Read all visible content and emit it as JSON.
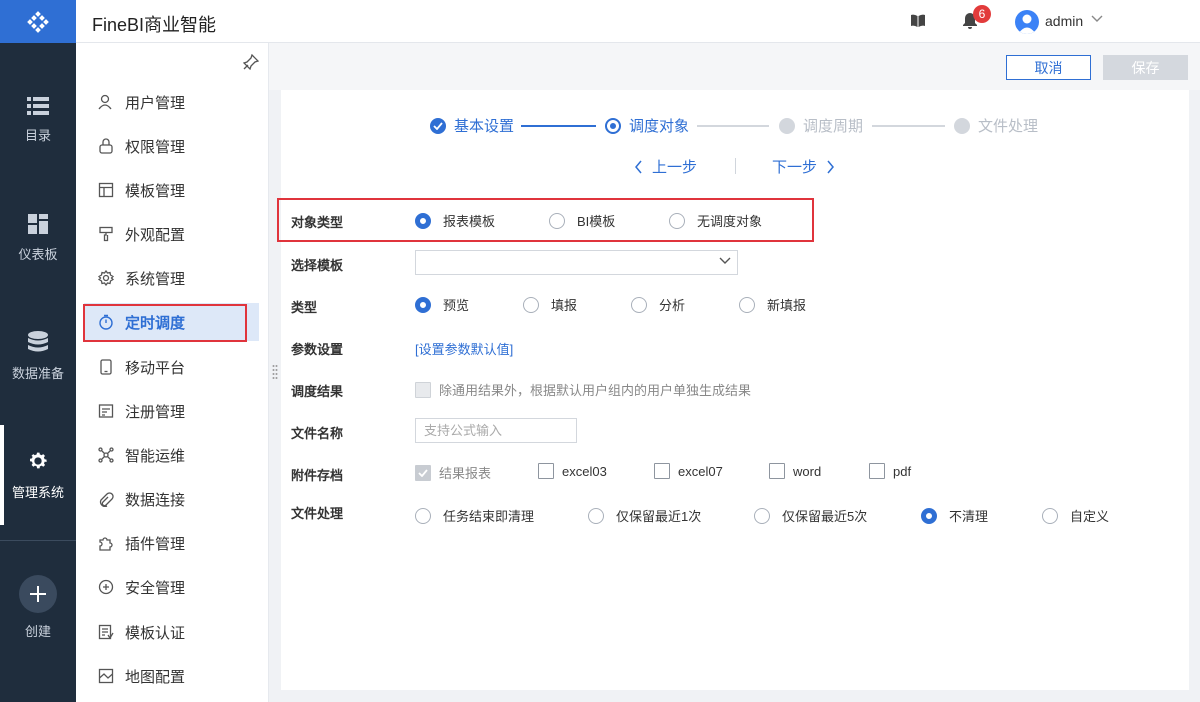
{
  "app": {
    "title": "FineBI商业智能"
  },
  "header": {
    "notification_count": "6",
    "user": "admin"
  },
  "rail": {
    "items": [
      {
        "label": "目录",
        "icon": "list-icon"
      },
      {
        "label": "仪表板",
        "icon": "dashboard-icon"
      },
      {
        "label": "数据准备",
        "icon": "database-icon"
      },
      {
        "label": "管理系统",
        "icon": "gear-icon",
        "active": true
      }
    ],
    "create_label": "创建"
  },
  "menu": {
    "items": [
      {
        "label": "用户管理",
        "icon": "user-icon"
      },
      {
        "label": "权限管理",
        "icon": "lock-icon"
      },
      {
        "label": "模板管理",
        "icon": "template-icon"
      },
      {
        "label": "外观配置",
        "icon": "brush-icon"
      },
      {
        "label": "系统管理",
        "icon": "gear-icon"
      },
      {
        "label": "定时调度",
        "icon": "timer-icon",
        "active": true
      },
      {
        "label": "移动平台",
        "icon": "mobile-icon"
      },
      {
        "label": "注册管理",
        "icon": "register-icon"
      },
      {
        "label": "智能运维",
        "icon": "network-icon"
      },
      {
        "label": "数据连接",
        "icon": "link-icon"
      },
      {
        "label": "插件管理",
        "icon": "puzzle-icon"
      },
      {
        "label": "安全管理",
        "icon": "shield-icon"
      },
      {
        "label": "模板认证",
        "icon": "certificate-icon"
      },
      {
        "label": "地图配置",
        "icon": "map-icon"
      }
    ]
  },
  "toolbar": {
    "cancel_label": "取消",
    "save_label": "保存"
  },
  "steps": [
    {
      "label": "基本设置",
      "state": "done"
    },
    {
      "label": "调度对象",
      "state": "current"
    },
    {
      "label": "调度周期",
      "state": "todo"
    },
    {
      "label": "文件处理",
      "state": "todo"
    }
  ],
  "nav": {
    "prev_label": "上一步",
    "next_label": "下一步"
  },
  "form": {
    "object_type": {
      "label": "对象类型",
      "options": [
        "报表模板",
        "BI模板",
        "无调度对象"
      ],
      "selected": 0
    },
    "select_template": {
      "label": "选择模板",
      "value": ""
    },
    "type": {
      "label": "类型",
      "options": [
        "预览",
        "填报",
        "分析",
        "新填报"
      ],
      "selected": 0
    },
    "params": {
      "label": "参数设置",
      "link": "[设置参数默认值]"
    },
    "result": {
      "label": "调度结果",
      "checkbox_label": "除通用结果外，根据默认用户组内的用户单独生成结果"
    },
    "file_name": {
      "label": "文件名称",
      "placeholder": "支持公式输入",
      "value": ""
    },
    "attachments": {
      "label": "附件存档",
      "options": [
        "结果报表",
        "excel03",
        "excel07",
        "word",
        "pdf"
      ],
      "checked": [
        0
      ]
    },
    "file_processing": {
      "label": "文件处理",
      "options": [
        "任务结束即清理",
        "仅保留最近1次",
        "仅保留最近5次",
        "不清理",
        "自定义"
      ],
      "selected": 3
    }
  },
  "colors": {
    "primary": "#2f6fd4",
    "rail_bg": "#1f2d3d",
    "highlight_box": "#e0343c"
  }
}
